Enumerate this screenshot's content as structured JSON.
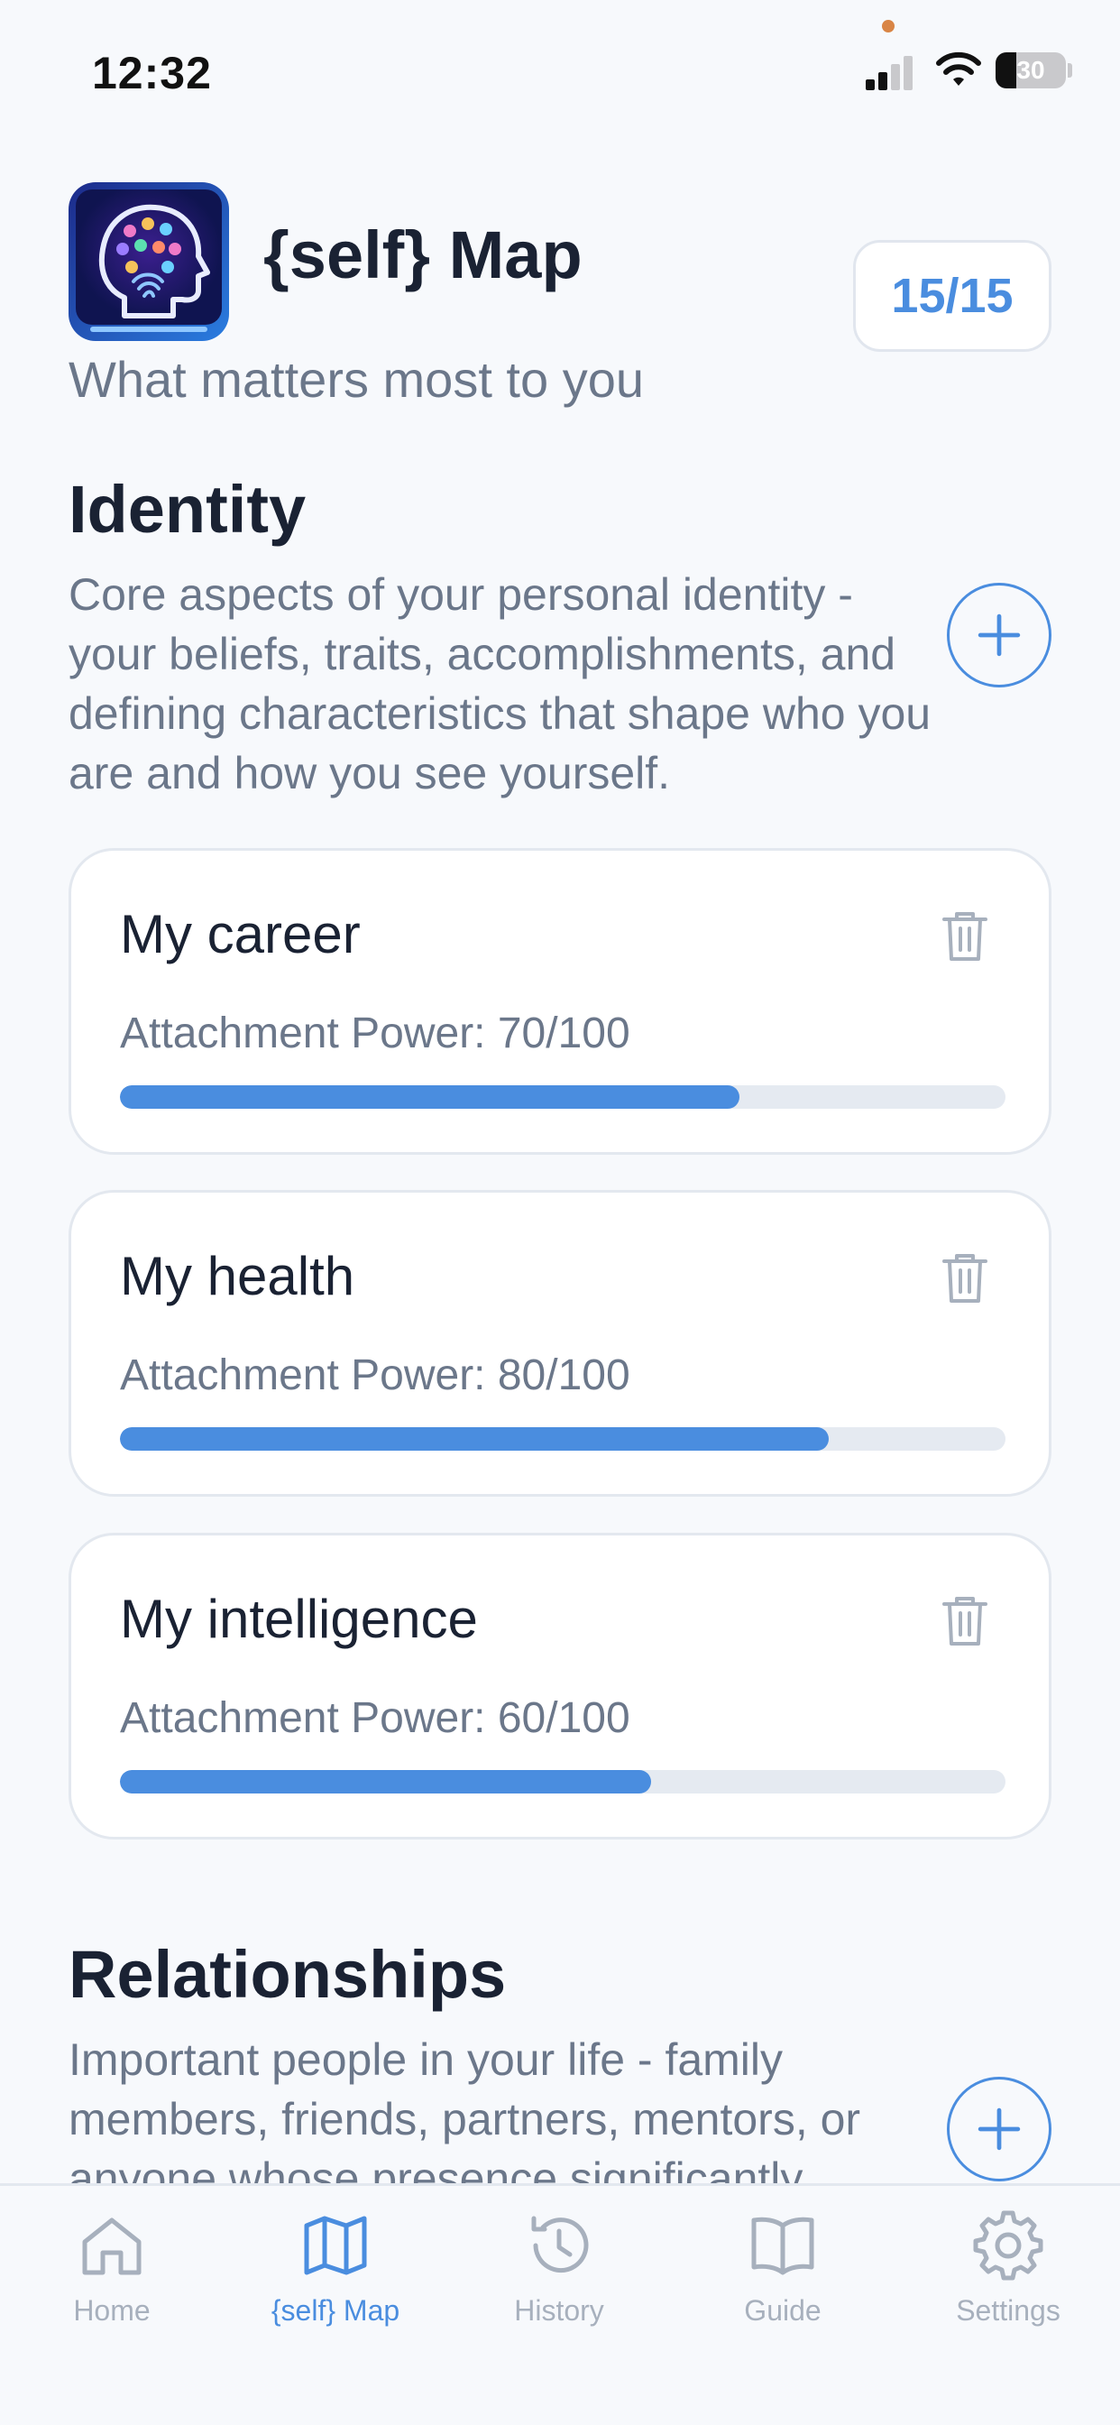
{
  "status_bar": {
    "time": "12:32",
    "battery": "30",
    "battery_level": 0.3
  },
  "header": {
    "title": "{self} Map",
    "subtitle": "What matters most to you",
    "counter": "15/15",
    "logo_icon": "brain-head-icon"
  },
  "sections": [
    {
      "title": "Identity",
      "description": "Core aspects of your personal identity - your beliefs, traits, accomplishments, and defining characteristics that shape who you are and how you see yourself.",
      "add_icon": "plus-icon"
    },
    {
      "title": "Relationships",
      "description": "Important people in your life - family members, friends, partners, mentors, or anyone whose presence significantly",
      "add_icon": "plus-icon"
    }
  ],
  "cards": [
    {
      "title": "My career",
      "attachment": "Attachment Power: 70/100",
      "value": 70,
      "max": 100
    },
    {
      "title": "My health",
      "attachment": "Attachment Power: 80/100",
      "value": 80,
      "max": 100
    },
    {
      "title": "My intelligence",
      "attachment": "Attachment Power: 60/100",
      "value": 60,
      "max": 100
    }
  ],
  "tabs": [
    {
      "label": "Home",
      "icon": "home-icon",
      "active": false
    },
    {
      "label": "{self} Map",
      "icon": "map-icon",
      "active": true
    },
    {
      "label": "History",
      "icon": "history-icon",
      "active": false
    },
    {
      "label": "Guide",
      "icon": "book-icon",
      "active": false
    },
    {
      "label": "Settings",
      "icon": "gear-icon",
      "active": false
    }
  ],
  "colors": {
    "accent": "#4a8ddf",
    "text_primary": "#1a2233",
    "text_secondary": "#6b778a",
    "tab_inactive": "#a7b0bd",
    "track": "#e5eaf1",
    "background": "#f7f9fc"
  }
}
